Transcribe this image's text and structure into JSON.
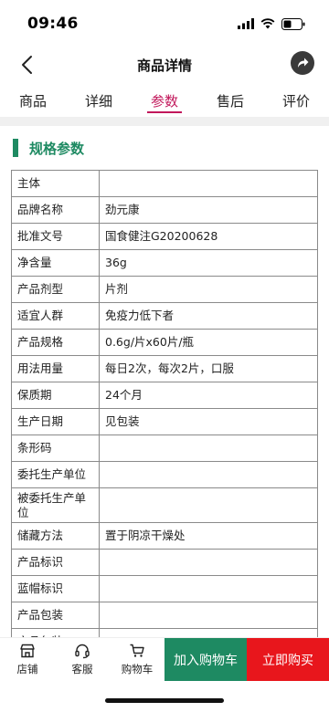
{
  "status": {
    "time": "09:46"
  },
  "nav": {
    "title": "商品详情",
    "back_icon": "chevron-left-icon",
    "share_icon": "share-arrow-icon"
  },
  "tabs": [
    {
      "label": "商品",
      "active": false
    },
    {
      "label": "详细",
      "active": false
    },
    {
      "label": "参数",
      "active": true
    },
    {
      "label": "售后",
      "active": false
    },
    {
      "label": "评价",
      "active": false
    }
  ],
  "section": {
    "title": "规格参数"
  },
  "spec_rows": [
    {
      "key": "主体",
      "value": ""
    },
    {
      "key": "品牌名称",
      "value": "劲元康"
    },
    {
      "key": "批准文号",
      "value": "国食健注G20200628"
    },
    {
      "key": "净含量",
      "value": "36g"
    },
    {
      "key": "产品剂型",
      "value": "片剂"
    },
    {
      "key": "适宜人群",
      "value": "免疫力低下者"
    },
    {
      "key": "产品规格",
      "value": "0.6g/片x60片/瓶"
    },
    {
      "key": "用法用量",
      "value": "每日2次，每次2片，口服"
    },
    {
      "key": "保质期",
      "value": "24个月"
    },
    {
      "key": "生产日期",
      "value": "见包装"
    },
    {
      "key": "条形码",
      "value": ""
    },
    {
      "key": "委托生产单位",
      "value": ""
    },
    {
      "key": "被委托生产单位",
      "value": ""
    },
    {
      "key": "储藏方法",
      "value": "置于阴凉干燥处"
    },
    {
      "key": "产品标识",
      "value": ""
    },
    {
      "key": "蓝帽标识",
      "value": ""
    },
    {
      "key": "产品包装",
      "value": ""
    },
    {
      "key": "产品包装",
      "value": ""
    }
  ],
  "bottom": {
    "store": "店铺",
    "service": "客服",
    "cart": "购物车",
    "add_cart": "加入购物车",
    "buy_now": "立即购买"
  },
  "colors": {
    "accent_green": "#1e8a62",
    "tab_active": "#c2185b",
    "buy_red": "#e8161c"
  }
}
